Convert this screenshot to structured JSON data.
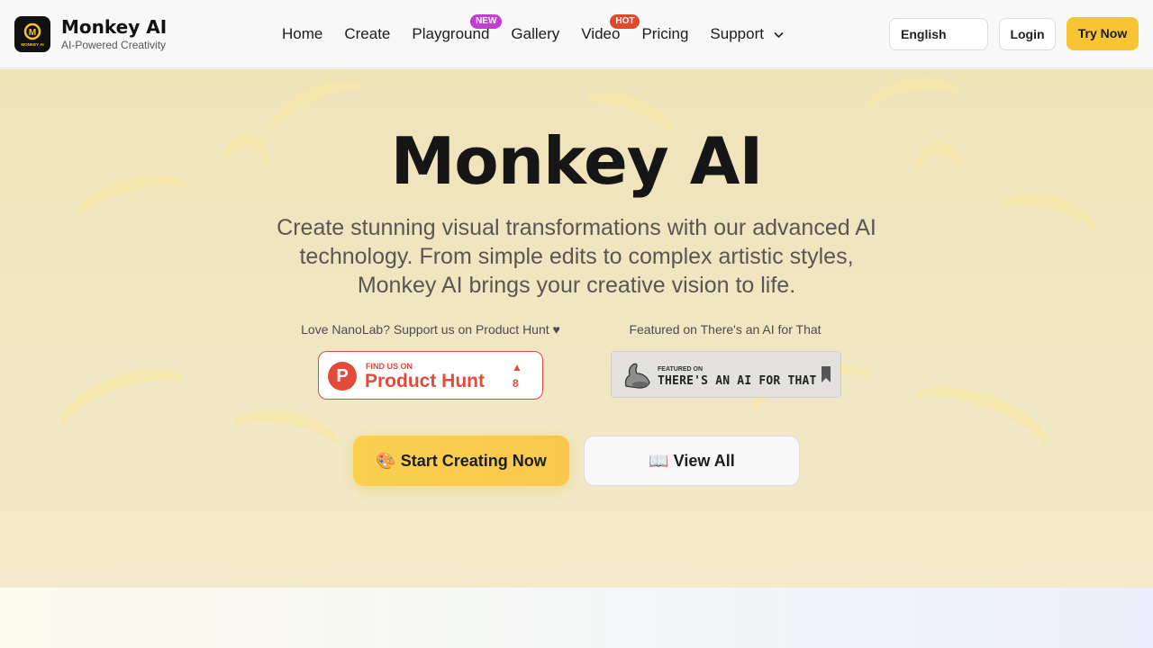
{
  "header": {
    "brand_name": "Monkey AI",
    "brand_tagline": "AI-Powered Creativity",
    "logo_text": "MONKEY AI",
    "nav": [
      {
        "label": "Home"
      },
      {
        "label": "Create"
      },
      {
        "label": "Playground",
        "badge": "NEW"
      },
      {
        "label": "Gallery"
      },
      {
        "label": "Video",
        "badge": "HOT"
      },
      {
        "label": "Pricing"
      },
      {
        "label": "Support"
      }
    ],
    "language": "English",
    "login_label": "Login",
    "try_label": "Try Now"
  },
  "hero": {
    "title": "Monkey AI",
    "subtitle": "Create stunning visual transformations with our advanced AI technology. From simple edits to complex artistic styles, Monkey AI brings your creative vision to life.",
    "producthunt_caption": "Love NanoLab? Support us on Product Hunt ♥",
    "producthunt_small": "FIND US ON",
    "producthunt_big": "Product Hunt",
    "producthunt_count": "8",
    "aift_caption": "Featured on There's an AI for That",
    "aift_small": "FEATURED ON",
    "aift_big": "THERE'S AN AI FOR THAT",
    "start_button": "🎨 Start Creating Now",
    "view_button": "📖 View All"
  },
  "colors": {
    "accent": "#f7c533",
    "producthunt": "#e34a3a",
    "badge_new": "#c13ed0",
    "badge_hot": "#e04a2a"
  }
}
